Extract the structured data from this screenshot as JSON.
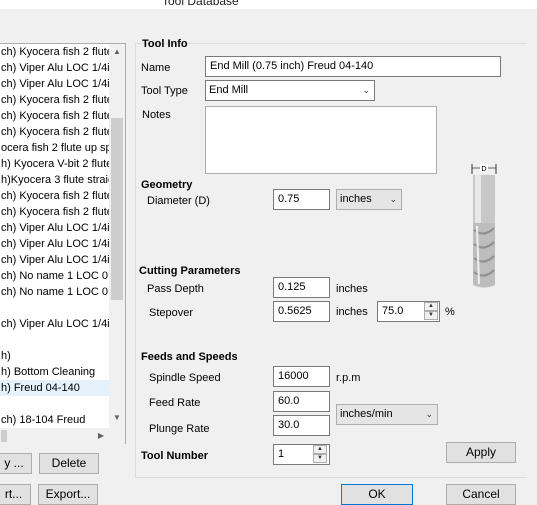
{
  "window": {
    "title": "Tool Database"
  },
  "tool_list": {
    "items": [
      "ch) Kyocera fish 2 flute",
      "ch) Viper Alu  LOC 1/4ir",
      "ch) Viper Alu  LOC 1/4ir",
      "ch) Kyocera fish 2 flute",
      "ch) Kyocera fish 2 flute",
      "ch) Kyocera fish 2 flute",
      "ocera fish 2 flute up sp",
      "h) Kyocera V-bit  2 flute",
      "h)Kyocera 3  flute straic",
      "ch) Kyocera fish 2 flute",
      "ch) Kyocera fish 2 flute",
      "ch) Viper Alu  LOC 1/4ir",
      "ch) Viper Alu  LOC 1/4ir",
      "ch) Viper Alu  LOC 1/4ir",
      "ch) No name 1  LOC 0,2i",
      "ch) No name 1  LOC 0,2i",
      "",
      "ch) Viper Alu  LOC 1/4ir",
      "",
      "h)",
      "h) Bottom Cleaning",
      "h) Freud 04-140",
      "",
      "ch) 18-104 Freud"
    ],
    "selected_index": 21
  },
  "left_buttons": {
    "copy": "y ...",
    "delete": "Delete",
    "import": "rt...",
    "export": "Export..."
  },
  "tool_info": {
    "header": "Tool Info",
    "name_label": "Name",
    "name_value": "End Mill (0.75 inch) Freud 04-140",
    "type_label": "Tool Type",
    "type_value": "End Mill",
    "notes_label": "Notes",
    "notes_value": ""
  },
  "geometry": {
    "header": "Geometry",
    "diameter_label": "Diameter (D)",
    "diameter_value": "0.75",
    "units_value": "inches",
    "diagram_label": "D"
  },
  "cutting": {
    "header": "Cutting Parameters",
    "pass_depth_label": "Pass Depth",
    "pass_depth_value": "0.125",
    "pass_depth_unit": "inches",
    "stepover_label": "Stepover",
    "stepover_value": "0.5625",
    "stepover_unit": "inches",
    "stepover_percent": "75.0",
    "percent_sign": "%"
  },
  "feeds": {
    "header": "Feeds and Speeds",
    "spindle_label": "Spindle Speed",
    "spindle_value": "16000",
    "spindle_unit": "r.p.m",
    "feed_label": "Feed Rate",
    "feed_value": "60.0",
    "plunge_label": "Plunge Rate",
    "plunge_value": "30.0",
    "rate_unit": "inches/min"
  },
  "tool_number": {
    "label": "Tool Number",
    "value": "1"
  },
  "buttons": {
    "apply": "Apply",
    "ok": "OK",
    "cancel": "Cancel"
  }
}
